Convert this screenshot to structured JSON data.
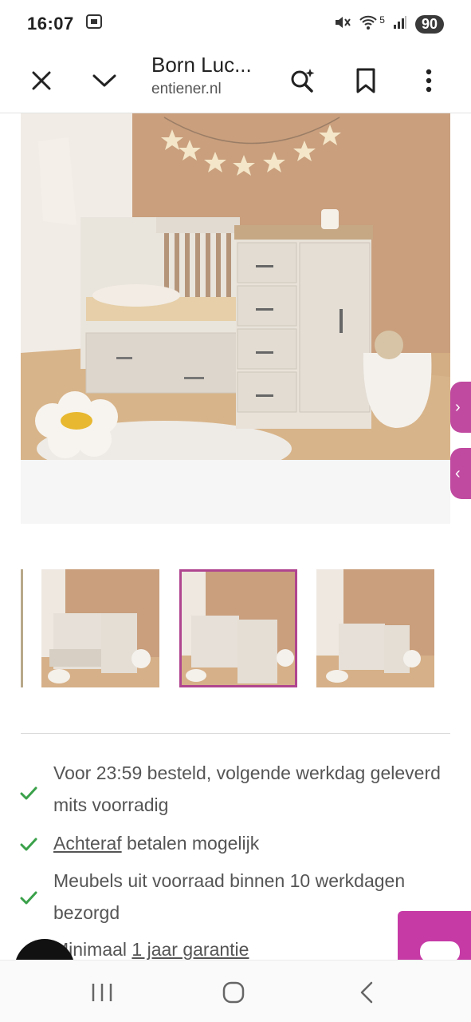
{
  "status_bar": {
    "time": "16:07",
    "battery": "90",
    "network": "5"
  },
  "toolbar": {
    "title": "Born Luc...",
    "url": "entiener.nl"
  },
  "side_tabs": {
    "top_label": "›",
    "bottom_label": "‹"
  },
  "usps": [
    {
      "text": "Voor 23:59 besteld, volgende werkdag geleverd mits voorradig"
    },
    {
      "link": "Achteraf",
      "text": " betalen mogelijk"
    },
    {
      "text": "Meubels uit voorraad binnen 10 werkdagen bezorgd"
    },
    {
      "prefix": "Minimaal ",
      "link": "1 jaar garantie"
    }
  ],
  "colors": {
    "accent": "#c63aa6",
    "check": "#3aa14a",
    "wall": "#c89f7e"
  }
}
